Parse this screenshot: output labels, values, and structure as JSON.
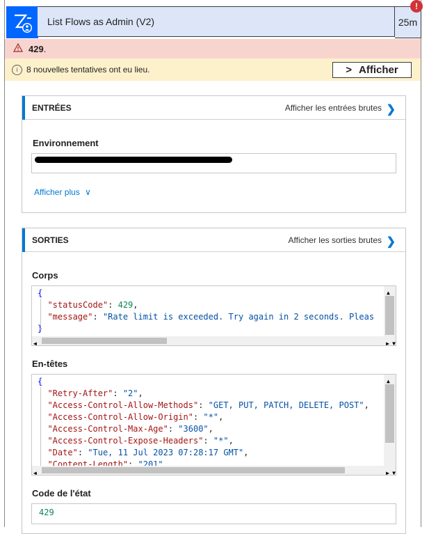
{
  "action": {
    "title": "List Flows as Admin (V2)",
    "duration": "25m",
    "icon": "power-automate-admin-icon",
    "error_badge": "!"
  },
  "error_bar": {
    "code": "429",
    "suffix": "."
  },
  "retry_bar": {
    "message": "8 nouvelles tentatives ont eu lieu.",
    "button_label": "Afficher"
  },
  "inputs": {
    "title": "ENTRÉES",
    "raw_link": "Afficher les entrées brutes",
    "env_label": "Environnement",
    "show_more": "Afficher plus"
  },
  "outputs": {
    "title": "SORTIES",
    "raw_link": "Afficher les sorties brutes",
    "body_label": "Corps",
    "body_lines": [
      {
        "t": "brace",
        "text": "{"
      },
      {
        "k": "\"statusCode\"",
        "v": "429",
        "vt": "num",
        "tail": ","
      },
      {
        "k": "\"message\"",
        "v": "\"Rate limit is exceeded. Try again in 2 seconds. Pleas",
        "vt": "str",
        "tail": ""
      },
      {
        "t": "brace",
        "text": "}"
      }
    ],
    "headers_label": "En-têtes",
    "headers_lines": [
      {
        "t": "brace",
        "text": "{"
      },
      {
        "k": "\"Retry-After\"",
        "v": "\"2\"",
        "vt": "str",
        "tail": ","
      },
      {
        "k": "\"Access-Control-Allow-Methods\"",
        "v": "\"GET, PUT, PATCH, DELETE, POST\"",
        "vt": "str",
        "tail": ","
      },
      {
        "k": "\"Access-Control-Allow-Origin\"",
        "v": "\"*\"",
        "vt": "str",
        "tail": ","
      },
      {
        "k": "\"Access-Control-Max-Age\"",
        "v": "\"3600\"",
        "vt": "str",
        "tail": ","
      },
      {
        "k": "\"Access-Control-Expose-Headers\"",
        "v": "\"*\"",
        "vt": "str",
        "tail": ","
      },
      {
        "k": "\"Date\"",
        "v": "\"Tue, 11 Jul 2023 07:28:17 GMT\"",
        "vt": "str",
        "tail": ","
      },
      {
        "k": "\"Content-Length\"",
        "v": "\"201\"",
        "vt": "str",
        "tail": ""
      }
    ],
    "status_label": "Code de l'état",
    "status_value": "429"
  },
  "colors": {
    "accent": "#0078d4",
    "error_bg": "#f8d4cf",
    "warning_bg": "#fdf1cc",
    "action_icon_bg": "#0066ff"
  }
}
